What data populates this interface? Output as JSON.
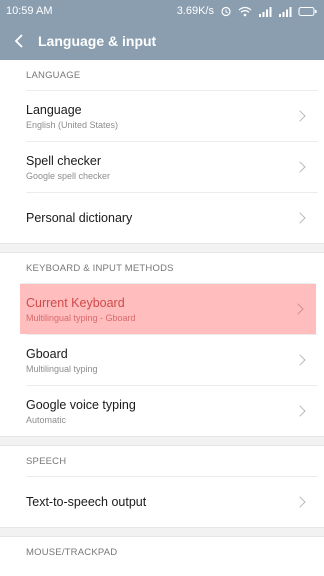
{
  "status": {
    "time": "10:59 AM",
    "speed": "3.69K/s",
    "icons": [
      "alarm-icon",
      "wifi-icon",
      "signal-icon",
      "signal-icon",
      "battery-icon"
    ]
  },
  "appbar": {
    "title": "Language & input"
  },
  "sections": {
    "language": "LANGUAGE",
    "keyboard": "KEYBOARD & INPUT METHODS",
    "speech": "SPEECH",
    "mouse": "MOUSE/TRACKPAD"
  },
  "items": {
    "language": {
      "title": "Language",
      "subtitle": "English (United States)"
    },
    "spell": {
      "title": "Spell checker",
      "subtitle": "Google spell checker"
    },
    "dictionary": {
      "title": "Personal dictionary"
    },
    "current_keyboard": {
      "title": "Current Keyboard",
      "subtitle": "Multilingual typing - Gboard"
    },
    "gboard": {
      "title": "Gboard",
      "subtitle": "Multilingual typing"
    },
    "voice": {
      "title": "Google voice typing",
      "subtitle": "Automatic"
    },
    "tts": {
      "title": "Text-to-speech output"
    }
  },
  "colors": {
    "bar": "#8a9eb0",
    "highlight": "#ffbdbd",
    "highlight_text": "#cf4b4b"
  }
}
